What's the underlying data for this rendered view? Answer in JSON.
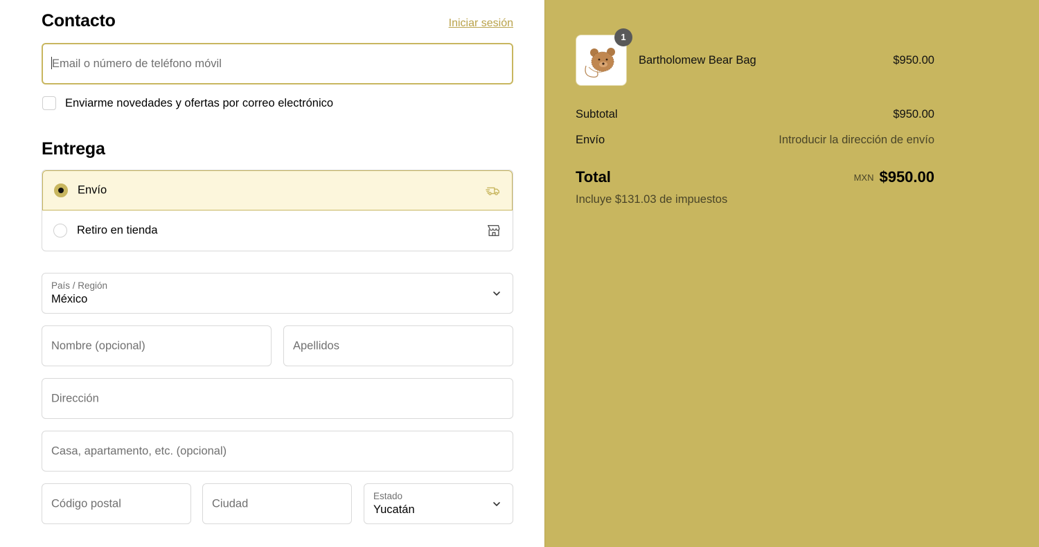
{
  "contact": {
    "title": "Contacto",
    "login_link": "Iniciar sesión",
    "email_placeholder": "Email o número de teléfono móvil",
    "newsletter_label": "Enviarme novedades y ofertas por correo electrónico"
  },
  "delivery": {
    "title": "Entrega",
    "options": [
      {
        "label": "Envío",
        "icon": "truck-icon",
        "selected": true
      },
      {
        "label": "Retiro en tienda",
        "icon": "store-icon",
        "selected": false
      }
    ]
  },
  "address": {
    "country_label": "País / Región",
    "country_value": "México",
    "first_name_placeholder": "Nombre (opcional)",
    "last_name_placeholder": "Apellidos",
    "address_placeholder": "Dirección",
    "apartment_placeholder": "Casa, apartamento, etc. (opcional)",
    "postal_placeholder": "Código postal",
    "city_placeholder": "Ciudad",
    "state_label": "Estado",
    "state_value": "Yucatán"
  },
  "summary": {
    "item": {
      "name": "Bartholomew Bear Bag",
      "price": "$950.00",
      "quantity": "1"
    },
    "subtotal_label": "Subtotal",
    "subtotal_value": "$950.00",
    "shipping_label": "Envío",
    "shipping_value": "Introducir la dirección de envío",
    "total_label": "Total",
    "currency": "MXN",
    "total_value": "$950.00",
    "tax_note": "Incluye $131.03 de impuestos"
  },
  "colors": {
    "accent": "#c8b65f",
    "selected_bg": "#fcf6dc",
    "link": "#b9a24a",
    "summary_bg": "#c8b65f"
  }
}
